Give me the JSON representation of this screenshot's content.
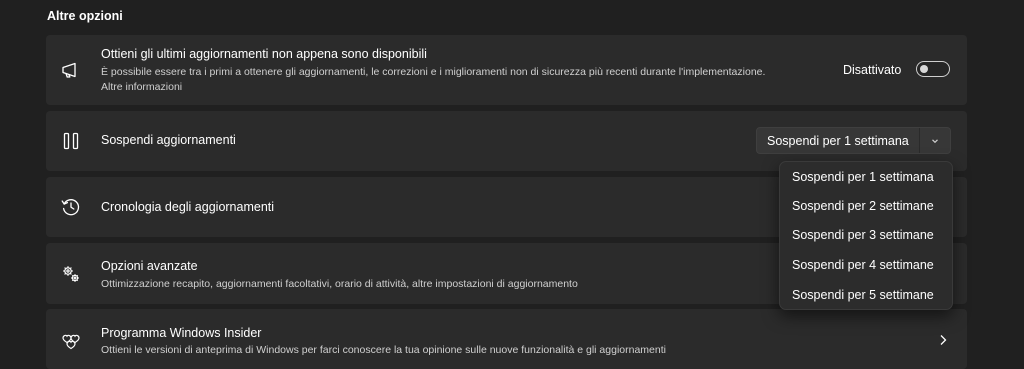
{
  "section_title": "Altre opzioni",
  "insider_updates": {
    "title": "Ottieni gli ultimi aggiornamenti non appena sono disponibili",
    "description": "È possibile essere tra i primi a ottenere gli aggiornamenti, le correzioni e i miglioramenti non di sicurezza più recenti durante l'implementazione.",
    "link": "Altre informazioni",
    "toggle_label": "Disattivato",
    "toggle_on": false,
    "icon": "megaphone-icon"
  },
  "pause_updates": {
    "title": "Sospendi aggiornamenti",
    "selected": "Sospendi per 1 settimana",
    "icon": "pause-icon",
    "options": [
      "Sospendi per 1 settimana",
      "Sospendi per 2 settimane",
      "Sospendi per 3 settimane",
      "Sospendi per 4 settimane",
      "Sospendi per 5 settimane"
    ]
  },
  "history": {
    "title": "Cronologia degli aggiornamenti",
    "icon": "history-icon"
  },
  "advanced": {
    "title": "Opzioni avanzate",
    "description": "Ottimizzazione recapito, aggiornamenti facoltativi, orario di attività, altre impostazioni di aggiornamento",
    "icon": "gears-icon"
  },
  "insider_program": {
    "title": "Programma Windows Insider",
    "description": "Ottieni le versioni di anteprima di Windows per farci conoscere la tua opinione sulle nuove funzionalità e gli aggiornamenti",
    "icon": "insider-hearts-icon"
  }
}
